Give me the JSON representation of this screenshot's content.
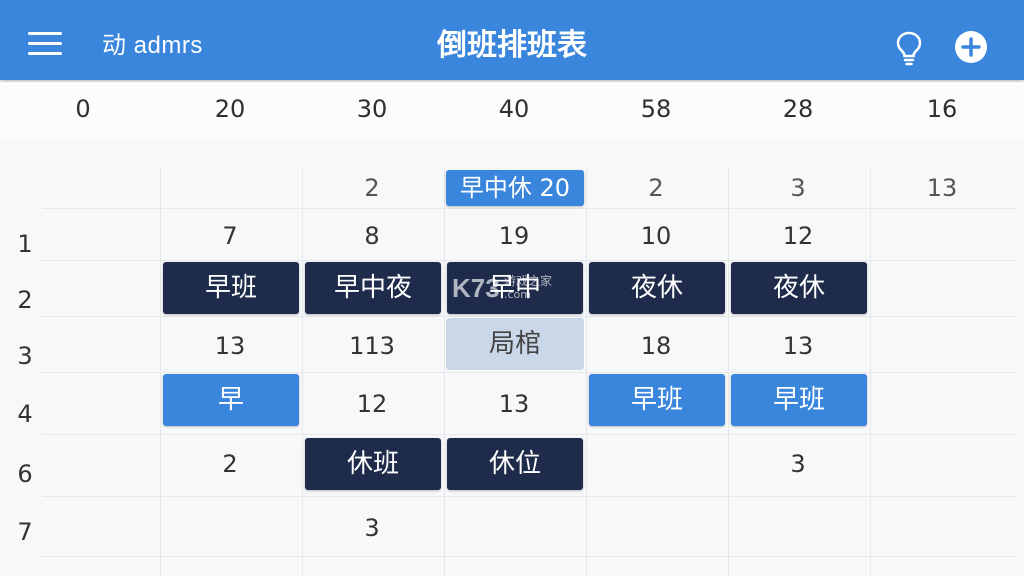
{
  "appbar": {
    "subtitle": "动 admrs",
    "title": "倒班排班表",
    "icons": {
      "menu": "menu-icon",
      "bulb": "lightbulb-icon",
      "add": "add-circle-icon"
    },
    "color": "#3a86dc"
  },
  "columns": [
    "0",
    "20",
    "30",
    "40",
    "58",
    "28",
    "16"
  ],
  "row_labels": [
    "1",
    "2",
    "3",
    "4",
    "6",
    "7"
  ],
  "cells": {
    "r0": [
      "2",
      "早中休 20",
      "2",
      "3",
      "13"
    ],
    "r1": [
      "7",
      "8",
      "19",
      "10",
      "12"
    ],
    "r2": [
      "早班",
      "早中夜",
      "早中",
      "夜休",
      "夜休"
    ],
    "r3": [
      "13",
      "113",
      "局棺",
      "18",
      "13"
    ],
    "r4": [
      "早",
      "12",
      "13",
      "早班",
      "早班"
    ],
    "r5": [
      "2",
      "休班",
      "休位",
      "3"
    ],
    "r6": [
      "3"
    ]
  },
  "watermark": {
    "logo": "K73",
    "text": "游戏之家",
    "url": ".com"
  },
  "colors": {
    "dark_chip": "#1e2b4a",
    "blue_chip": "#3a86dc",
    "pale_chip": "#c9d7e8"
  }
}
